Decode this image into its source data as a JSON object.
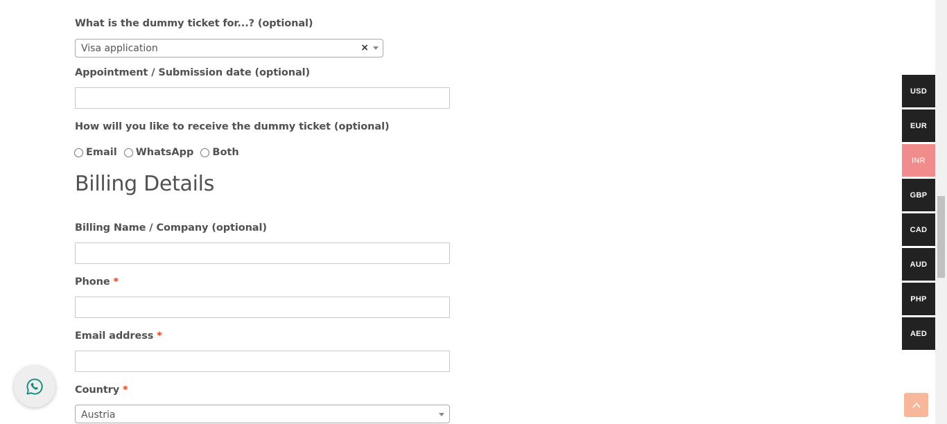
{
  "purpose": {
    "label": "What is the dummy ticket for...? (optional)",
    "selected": "Visa application",
    "clear_symbol": "×"
  },
  "appointment": {
    "label": "Appointment / Submission date (optional)",
    "value": ""
  },
  "delivery": {
    "label": "How will you like to receive the dummy ticket (optional)",
    "options": [
      "Email",
      "WhatsApp",
      "Both"
    ]
  },
  "billing": {
    "heading": "Billing Details",
    "name_label": "Billing Name / Company (optional)",
    "phone_label": "Phone",
    "email_label": "Email address",
    "country_label": "Country",
    "country_value": "Austria",
    "required_mark": "*"
  },
  "currencies": [
    {
      "code": "USD",
      "active": false
    },
    {
      "code": "EUR",
      "active": false
    },
    {
      "code": "INR",
      "active": true
    },
    {
      "code": "GBP",
      "active": false
    },
    {
      "code": "CAD",
      "active": false
    },
    {
      "code": "AUD",
      "active": false
    },
    {
      "code": "PHP",
      "active": false
    },
    {
      "code": "AED",
      "active": false
    }
  ],
  "colors": {
    "required": "#e2401c",
    "currency_bg": "#222222",
    "currency_active_bg": "#f08c8c",
    "whatsapp_icon": "#128c7e",
    "back_to_top_bg": "#f7b79a"
  },
  "icons": {
    "whatsapp": "whatsapp-icon",
    "back_to_top": "chevron-up-icon",
    "dropdown": "caret-down-icon"
  }
}
